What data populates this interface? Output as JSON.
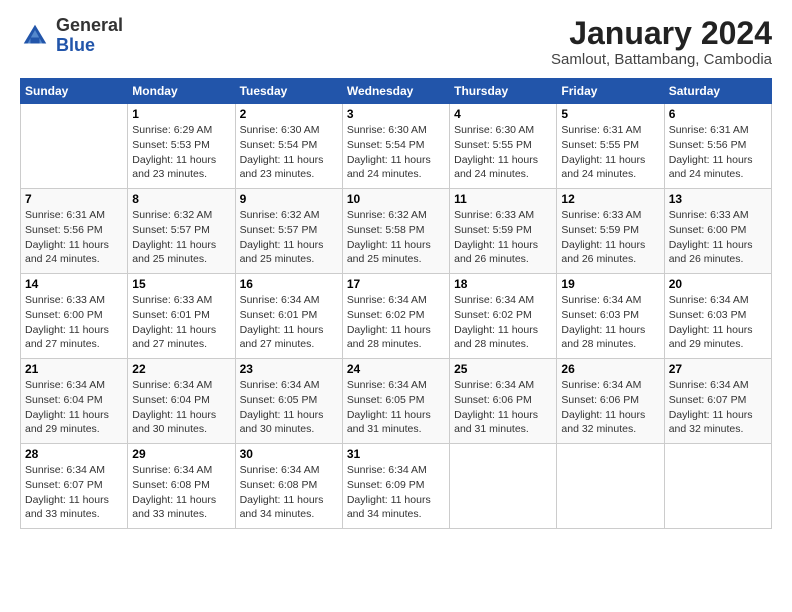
{
  "header": {
    "logo_general": "General",
    "logo_blue": "Blue",
    "month_title": "January 2024",
    "subtitle": "Samlout, Battambang, Cambodia"
  },
  "weekdays": [
    "Sunday",
    "Monday",
    "Tuesday",
    "Wednesday",
    "Thursday",
    "Friday",
    "Saturday"
  ],
  "weeks": [
    [
      {
        "day": "",
        "info": ""
      },
      {
        "day": "1",
        "info": "Sunrise: 6:29 AM\nSunset: 5:53 PM\nDaylight: 11 hours\nand 23 minutes."
      },
      {
        "day": "2",
        "info": "Sunrise: 6:30 AM\nSunset: 5:54 PM\nDaylight: 11 hours\nand 23 minutes."
      },
      {
        "day": "3",
        "info": "Sunrise: 6:30 AM\nSunset: 5:54 PM\nDaylight: 11 hours\nand 24 minutes."
      },
      {
        "day": "4",
        "info": "Sunrise: 6:30 AM\nSunset: 5:55 PM\nDaylight: 11 hours\nand 24 minutes."
      },
      {
        "day": "5",
        "info": "Sunrise: 6:31 AM\nSunset: 5:55 PM\nDaylight: 11 hours\nand 24 minutes."
      },
      {
        "day": "6",
        "info": "Sunrise: 6:31 AM\nSunset: 5:56 PM\nDaylight: 11 hours\nand 24 minutes."
      }
    ],
    [
      {
        "day": "7",
        "info": "Sunrise: 6:31 AM\nSunset: 5:56 PM\nDaylight: 11 hours\nand 24 minutes."
      },
      {
        "day": "8",
        "info": "Sunrise: 6:32 AM\nSunset: 5:57 PM\nDaylight: 11 hours\nand 25 minutes."
      },
      {
        "day": "9",
        "info": "Sunrise: 6:32 AM\nSunset: 5:57 PM\nDaylight: 11 hours\nand 25 minutes."
      },
      {
        "day": "10",
        "info": "Sunrise: 6:32 AM\nSunset: 5:58 PM\nDaylight: 11 hours\nand 25 minutes."
      },
      {
        "day": "11",
        "info": "Sunrise: 6:33 AM\nSunset: 5:59 PM\nDaylight: 11 hours\nand 26 minutes."
      },
      {
        "day": "12",
        "info": "Sunrise: 6:33 AM\nSunset: 5:59 PM\nDaylight: 11 hours\nand 26 minutes."
      },
      {
        "day": "13",
        "info": "Sunrise: 6:33 AM\nSunset: 6:00 PM\nDaylight: 11 hours\nand 26 minutes."
      }
    ],
    [
      {
        "day": "14",
        "info": "Sunrise: 6:33 AM\nSunset: 6:00 PM\nDaylight: 11 hours\nand 27 minutes."
      },
      {
        "day": "15",
        "info": "Sunrise: 6:33 AM\nSunset: 6:01 PM\nDaylight: 11 hours\nand 27 minutes."
      },
      {
        "day": "16",
        "info": "Sunrise: 6:34 AM\nSunset: 6:01 PM\nDaylight: 11 hours\nand 27 minutes."
      },
      {
        "day": "17",
        "info": "Sunrise: 6:34 AM\nSunset: 6:02 PM\nDaylight: 11 hours\nand 28 minutes."
      },
      {
        "day": "18",
        "info": "Sunrise: 6:34 AM\nSunset: 6:02 PM\nDaylight: 11 hours\nand 28 minutes."
      },
      {
        "day": "19",
        "info": "Sunrise: 6:34 AM\nSunset: 6:03 PM\nDaylight: 11 hours\nand 28 minutes."
      },
      {
        "day": "20",
        "info": "Sunrise: 6:34 AM\nSunset: 6:03 PM\nDaylight: 11 hours\nand 29 minutes."
      }
    ],
    [
      {
        "day": "21",
        "info": "Sunrise: 6:34 AM\nSunset: 6:04 PM\nDaylight: 11 hours\nand 29 minutes."
      },
      {
        "day": "22",
        "info": "Sunrise: 6:34 AM\nSunset: 6:04 PM\nDaylight: 11 hours\nand 30 minutes."
      },
      {
        "day": "23",
        "info": "Sunrise: 6:34 AM\nSunset: 6:05 PM\nDaylight: 11 hours\nand 30 minutes."
      },
      {
        "day": "24",
        "info": "Sunrise: 6:34 AM\nSunset: 6:05 PM\nDaylight: 11 hours\nand 31 minutes."
      },
      {
        "day": "25",
        "info": "Sunrise: 6:34 AM\nSunset: 6:06 PM\nDaylight: 11 hours\nand 31 minutes."
      },
      {
        "day": "26",
        "info": "Sunrise: 6:34 AM\nSunset: 6:06 PM\nDaylight: 11 hours\nand 32 minutes."
      },
      {
        "day": "27",
        "info": "Sunrise: 6:34 AM\nSunset: 6:07 PM\nDaylight: 11 hours\nand 32 minutes."
      }
    ],
    [
      {
        "day": "28",
        "info": "Sunrise: 6:34 AM\nSunset: 6:07 PM\nDaylight: 11 hours\nand 33 minutes."
      },
      {
        "day": "29",
        "info": "Sunrise: 6:34 AM\nSunset: 6:08 PM\nDaylight: 11 hours\nand 33 minutes."
      },
      {
        "day": "30",
        "info": "Sunrise: 6:34 AM\nSunset: 6:08 PM\nDaylight: 11 hours\nand 34 minutes."
      },
      {
        "day": "31",
        "info": "Sunrise: 6:34 AM\nSunset: 6:09 PM\nDaylight: 11 hours\nand 34 minutes."
      },
      {
        "day": "",
        "info": ""
      },
      {
        "day": "",
        "info": ""
      },
      {
        "day": "",
        "info": ""
      }
    ]
  ]
}
